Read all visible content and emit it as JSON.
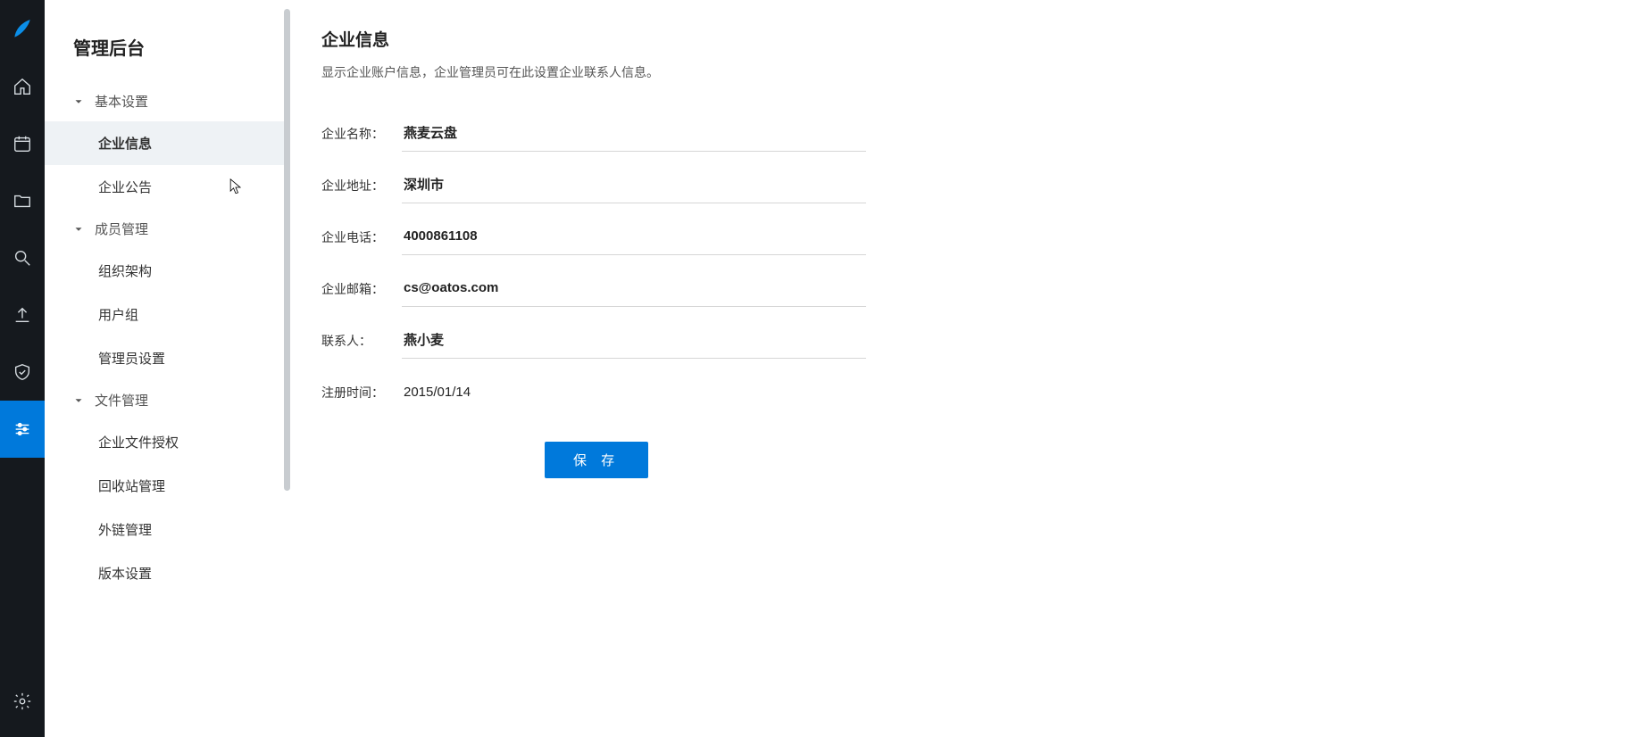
{
  "rail": {
    "items": [
      "home",
      "calendar",
      "folder",
      "search",
      "upload",
      "shield",
      "settings-active",
      "gear"
    ]
  },
  "sidebar": {
    "title": "管理后台",
    "sections": [
      {
        "label": "基本设置",
        "items": [
          {
            "label": "企业信息",
            "active": true
          },
          {
            "label": "企业公告"
          }
        ]
      },
      {
        "label": "成员管理",
        "items": [
          {
            "label": "组织架构"
          },
          {
            "label": "用户组"
          },
          {
            "label": "管理员设置"
          }
        ]
      },
      {
        "label": "文件管理",
        "items": [
          {
            "label": "企业文件授权"
          },
          {
            "label": "回收站管理"
          },
          {
            "label": "外链管理"
          },
          {
            "label": "版本设置"
          }
        ]
      }
    ]
  },
  "page": {
    "title": "企业信息",
    "subtitle": "显示企业账户信息，企业管理员可在此设置企业联系人信息。",
    "labels": {
      "name": "企业名称：",
      "address": "企业地址：",
      "phone": "企业电话：",
      "email": "企业邮箱：",
      "contact": "联系人：",
      "regdate": "注册时间："
    },
    "values": {
      "name": "燕麦云盘",
      "address": "深圳市",
      "phone": "4000861108",
      "email": "cs@oatos.com",
      "contact": "燕小麦",
      "regdate": "2015/01/14"
    },
    "save": "保 存"
  }
}
